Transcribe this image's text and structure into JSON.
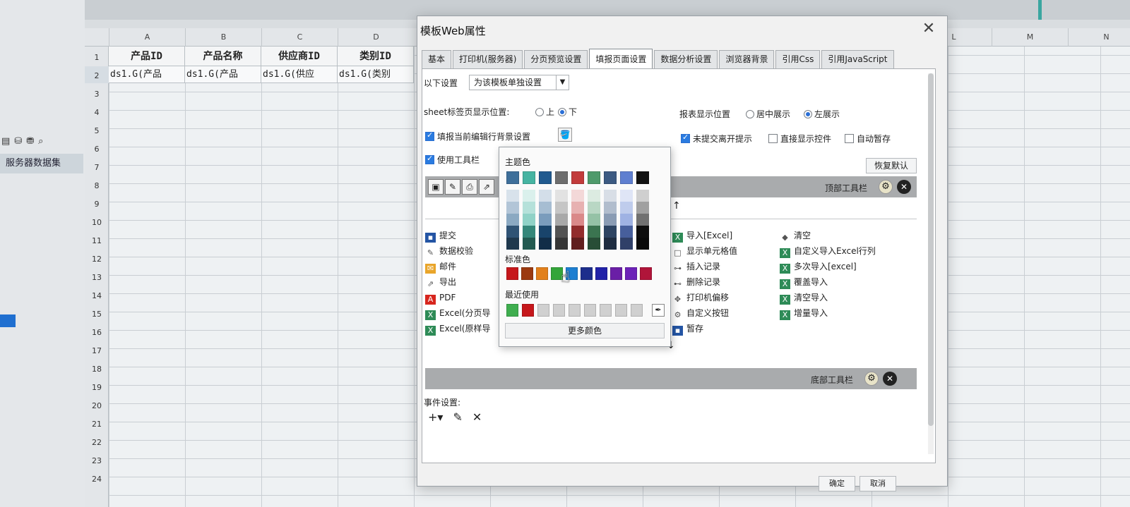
{
  "left_panel": {
    "dataset_label": "服务器数据集",
    "toolbar_icons": [
      "dataset-icon",
      "database-icon",
      "database-add-icon",
      "search-icon"
    ]
  },
  "spreadsheet": {
    "columns": [
      "A",
      "B",
      "C",
      "D",
      "L",
      "M",
      "N"
    ],
    "rows": [
      "1",
      "2",
      "3",
      "4",
      "5",
      "6",
      "7",
      "8",
      "9",
      "10",
      "11",
      "12",
      "13",
      "14",
      "15",
      "16",
      "17",
      "18",
      "19",
      "20",
      "21",
      "22",
      "23",
      "24"
    ],
    "headers": [
      "产品ID",
      "产品名称",
      "供应商ID",
      "类别ID"
    ],
    "bindings": [
      "ds1.G(产品",
      "ds1.G(产品",
      "ds1.G(供应",
      "ds1.G(类别"
    ]
  },
  "dialog": {
    "title": "模板Web属性",
    "tabs": [
      "基本",
      "打印机(服务器)",
      "分页预览设置",
      "填报页面设置",
      "数据分析设置",
      "浏览器背景",
      "引用Css",
      "引用JavaScript"
    ],
    "active_tab": "填报页面设置",
    "settings_label": "以下设置",
    "settings_value": "为该模板单独设置",
    "sheet_tab_pos_label": "sheet标签页显示位置:",
    "sheet_tab_top": "上",
    "sheet_tab_bottom": "下",
    "report_pos_label": "报表显示位置",
    "report_pos_center": "居中展示",
    "report_pos_left": "左展示",
    "fill_bg_label": "填报当前编辑行背景设置",
    "unsubmitted_label": "未提交离开提示",
    "direct_show_label": "直接显示控件",
    "auto_save_label": "自动暂存",
    "use_toolbar_label": "使用工具栏",
    "restore_default": "恢复默认",
    "top_toolbar": "顶部工具栏",
    "bottom_toolbar": "底部工具栏",
    "left_items": [
      "提交",
      "数据校验",
      "邮件",
      "导出",
      "PDF",
      "Excel(分页导",
      "Excel(原样导"
    ],
    "mid_items": [
      "导入[Excel]",
      "显示单元格值",
      "插入记录",
      "删除记录",
      "打印机偏移",
      "自定义按钮",
      "暂存"
    ],
    "right_items": [
      "清空",
      "自定义导入Excel行列",
      "多次导入[excel]",
      "覆盖导入",
      "清空导入",
      "增量导入"
    ],
    "event_settings": "事件设置:",
    "ok": "确定",
    "cancel": "取消"
  },
  "color_picker": {
    "theme_label": "主题色",
    "standard_label": "标准色",
    "recent_label": "最近使用",
    "more_colors": "更多颜色",
    "theme_colors": [
      "#3e6f9a",
      "#46b4a2",
      "#215a8f",
      "#6e6e6e",
      "#c23b3b",
      "#4f9a6b",
      "#3c5a82",
      "#5f7fd0",
      "#111111"
    ],
    "standard_colors": [
      "#c6171b",
      "#9b3a10",
      "#e2801c",
      "#34a53a",
      "#1d7fd1",
      "#1d2e8c",
      "#2222a8",
      "#6a1fa6",
      "#6d22b8",
      "#b0153a"
    ],
    "recent_colors": [
      "#3fae4f",
      "#c6171b",
      "#d0d0d0",
      "#d0d0d0",
      "#d0d0d0",
      "#d0d0d0",
      "#d0d0d0",
      "#d0d0d0",
      "#d0d0d0"
    ]
  }
}
